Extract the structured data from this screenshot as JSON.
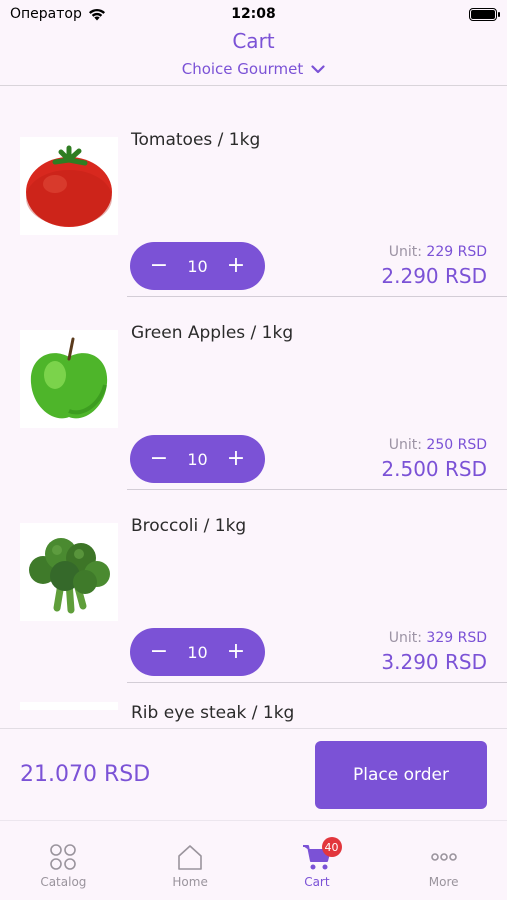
{
  "status_bar": {
    "carrier": "Оператор",
    "time": "12:08"
  },
  "header": {
    "title": "Cart",
    "store": "Choice Gourmet"
  },
  "items": [
    {
      "name": "Tomatoes / 1kg",
      "quantity": "10",
      "unit_label": "Unit:",
      "unit_price": "229 RSD",
      "total": "2.290 RSD",
      "image_icon": "tomato"
    },
    {
      "name": "Green Apples / 1kg",
      "quantity": "10",
      "unit_label": "Unit:",
      "unit_price": "250 RSD",
      "total": "2.500 RSD",
      "image_icon": "green-apple"
    },
    {
      "name": "Broccoli / 1kg",
      "quantity": "10",
      "unit_label": "Unit:",
      "unit_price": "329 RSD",
      "total": "3.290 RSD",
      "image_icon": "broccoli"
    },
    {
      "name": "Rib eye steak / 1kg"
    }
  ],
  "stepper": {
    "minus": "−",
    "plus": "+"
  },
  "order": {
    "total": "21.070 RSD",
    "place_order_label": "Place order"
  },
  "tabs": [
    {
      "label": "Catalog",
      "icon": "grid-circles-icon"
    },
    {
      "label": "Home",
      "icon": "home-icon"
    },
    {
      "label": "Cart",
      "icon": "cart-icon",
      "badge": "40",
      "active": true
    },
    {
      "label": "More",
      "icon": "more-dots-icon"
    }
  ],
  "colors": {
    "accent": "#7b52d6",
    "background": "#fcf5fc",
    "badge": "#e2363d"
  }
}
